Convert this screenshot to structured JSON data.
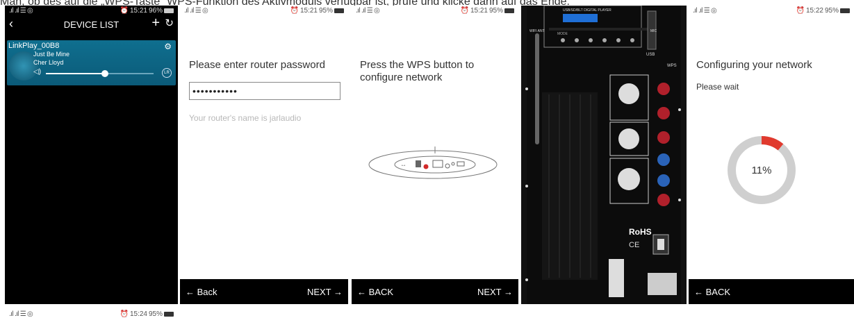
{
  "caption": "Man, ob des auf die „WPS-Taste“ WPS-Funktion des Aktivmoduls verfügbar ist, prüfe und klicke dann auf das Ende.",
  "panels": {
    "p1": {
      "status": {
        "signal": ".ıl .ıl ☰ ◎",
        "time": "15:21",
        "battery": "96%"
      },
      "header_title": "DEVICE LIST",
      "device": {
        "name": "LinkPlay_00B8",
        "song": "Just Be Mine",
        "artist": "Cher Lloyd",
        "volume_level": 0.55
      }
    },
    "p2": {
      "status": {
        "signal": ".ıl .ıl ☰ ◎",
        "time": "15:21",
        "battery": "95%"
      },
      "title": "Please enter router password",
      "password_value": "•••••••••••",
      "hint": "Your router's name is  jarlaudio",
      "back": "← Back",
      "next": "NEXT →"
    },
    "p3": {
      "status": {
        "signal": ".ıl .ıl ☰ ◎",
        "time": "15:21",
        "battery": "95%"
      },
      "title_line1": "Press the WPS button to",
      "title_line2": "configure network",
      "back": "← BACK",
      "next": "NEXT →"
    },
    "p4": {
      "player_label": "USB/SD/BLT DIGITAL PLAYER",
      "mode_label": "MODE",
      "wifi_ant": "WIFI ANT",
      "mic_label": "MIC",
      "usb_label": "USB",
      "wps_label": "WPS",
      "rohs": "RoHS",
      "ce": "CE"
    },
    "p5": {
      "status": {
        "signal": ".ıl .ıl ☰ ◎",
        "time": "15:22",
        "battery": "95%"
      },
      "title": "Configuring your network",
      "subtitle": "Please wait",
      "progress_percent": 11,
      "progress_label": "11%",
      "back": "← BACK"
    },
    "p6": {
      "status": {
        "signal": ".ıl .ıl ☰ ◎",
        "time": "15:24",
        "battery": "95%"
      }
    }
  },
  "colors": {
    "accent_blue": "#0f6f8f",
    "progress_red": "#e03a2e",
    "ring_gray": "#cfcfcf"
  }
}
